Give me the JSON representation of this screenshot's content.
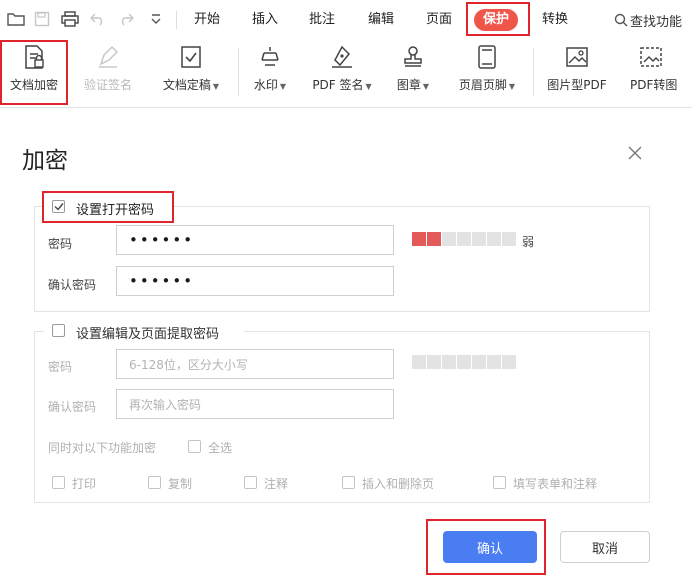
{
  "menubar": {
    "tabs": [
      "开始",
      "插入",
      "批注",
      "编辑",
      "页面",
      "保护",
      "转换"
    ],
    "search_text": "查找功能"
  },
  "ribbon": {
    "buttons": [
      "文档加密",
      "验证签名",
      "文档定稿",
      "水印",
      "PDF 签名",
      "图章",
      "页眉页脚",
      "图片型PDF",
      "PDF转图"
    ]
  },
  "dialog": {
    "title": "加密",
    "open_password": {
      "checkbox_label": "设置打开密码",
      "checked": true,
      "password_label": "密码",
      "password_value": "••••••",
      "confirm_label": "确认密码",
      "confirm_value": "••••••",
      "strength_label": "弱",
      "strength_level": 0.29
    },
    "edit_password": {
      "checkbox_label": "设置编辑及页面提取密码",
      "checked": false,
      "password_label": "密码",
      "password_placeholder": "6-128位，区分大小写",
      "confirm_label": "确认密码",
      "confirm_placeholder": "再次输入密码",
      "permissions_label": "同时对以下功能加密",
      "select_all_label": "全选",
      "permissions": [
        "打印",
        "复制",
        "注释",
        "插入和删除页",
        "填写表单和注释"
      ]
    },
    "confirm_button": "确认",
    "cancel_button": "取消"
  },
  "colors": {
    "accent": "#f0554a",
    "highlight_box": "#e0262c",
    "primary_button": "#4a7df2",
    "strength_filled": "#e45a5a",
    "strength_empty": "#e3e3e3"
  }
}
